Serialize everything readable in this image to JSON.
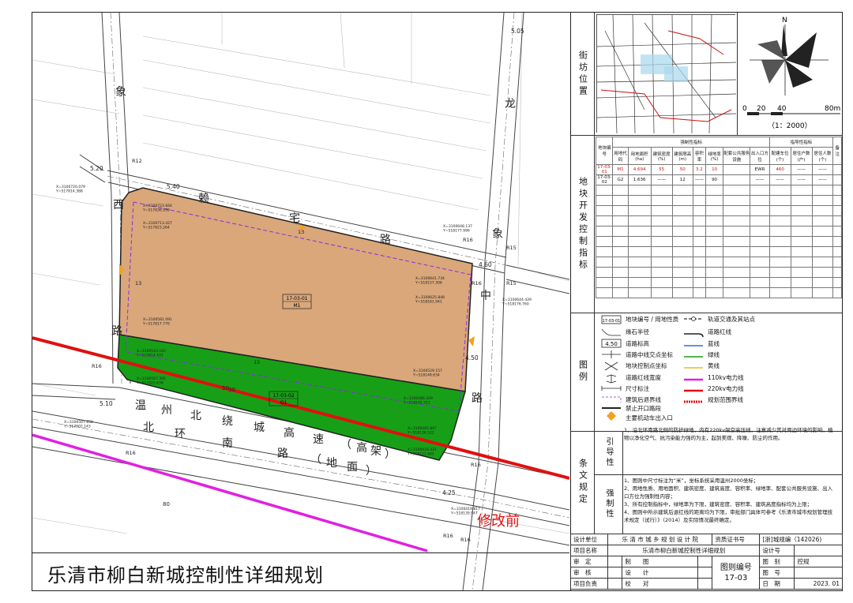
{
  "map": {
    "parcel_main": {
      "code": "17-03-01",
      "use": "M1"
    },
    "parcel_green": {
      "code": "17-03-02",
      "use": "G1"
    },
    "roads": {
      "xiang_west": "象",
      "xiang_west2": "西",
      "xiang_west3": "路",
      "long_east1": "龙",
      "long_east2": "象",
      "long_east3": "中",
      "long_east4": "路",
      "laizhai1": "赖",
      "laizhai2": "宅",
      "laizhai3": "路",
      "highway": [
        "温",
        "州",
        "北",
        "绕",
        "城",
        "高",
        "速",
        "（",
        "高",
        "架",
        "）"
      ],
      "ring": [
        "北",
        "环",
        "南",
        "路",
        "（",
        "地",
        "面",
        "）"
      ]
    },
    "dims": [
      "5.05",
      "5.20",
      "5.40",
      "4.60",
      "4.50",
      "5.10",
      "4.25",
      "R12",
      "R16",
      "R16",
      "R15",
      "R15",
      "R16",
      "R16",
      "R16",
      "R16",
      "R16",
      "13",
      "13",
      "15",
      "30",
      "50",
      "80"
    ],
    "coords": [
      "X=3100720.079\nY=517814.388",
      "X=3100723.664\nY=517836.939",
      "X=3100713.427\nY=517823.264",
      "X=3100648.137\nY=518177.996",
      "X=3100641.734\nY=518157.306",
      "X=3100625.848\nY=518161.941",
      "X=3100644.429\nY=518176.760",
      "X=3100581.091\nY=517817.770",
      "X=3100543.162\nY=517814.431",
      "X=3100507.395\nY=517825.638",
      "X=3100529.157\nY=518148.634",
      "X=3100486.309\nY=518142.311",
      "X=3100507.658\nY=517802.143",
      "X=3100465.867\nY=518136.522",
      "X=3100433.321\nY=518121.665",
      "X=3100419.817\nY=518139.947"
    ],
    "revision_stamp": "修改前"
  },
  "title": "乐清市柳白新城控制性详细规划",
  "side": {
    "location_title": "街坊位置",
    "scale_text": "（1：2000）",
    "scale_ticks": [
      "0",
      "20",
      "40",
      "80m"
    ],
    "north_label": "N",
    "control_title": "地块开发控制指标",
    "control_header_groups": [
      "强制性指标",
      "指导性指标"
    ],
    "control_headers": [
      "地块编号",
      "用地代码",
      "用地面积(ha)",
      "建筑密度(%)",
      "建筑限高(m)",
      "容积率",
      "绿地率(%)",
      "配套公共服务设施",
      "出入口方位",
      "配建车位(个)",
      "居住户数(户)",
      "居住人数(个)",
      "备注"
    ],
    "control_rows": [
      [
        "17-03-01",
        "M1",
        "4.694",
        "55",
        "50",
        "3.2",
        "10",
        "",
        "EWR",
        "460",
        "——",
        "——",
        ""
      ],
      [
        "17-03-02",
        "G2",
        "1.636",
        "——",
        "12",
        "——",
        "90",
        "",
        "——",
        "——",
        "——",
        "——",
        ""
      ]
    ],
    "legend_title": "图例",
    "legend_items": [
      [
        "地块编号 / 用地性质",
        "轨道交通及其站点"
      ],
      [
        "缘石半径",
        "道路红线"
      ],
      [
        "道路标高",
        "蓝线"
      ],
      [
        "道路中线交点坐标",
        "绿线"
      ],
      [
        "地块控制点坐标",
        "黄线"
      ],
      [
        "道路红线宽度",
        "110kv电力线"
      ],
      [
        "尺寸标注",
        "220kv电力线"
      ],
      [
        "建筑后退界线",
        "规划范围界线"
      ],
      [
        "禁止开口路段",
        ""
      ],
      [
        "主要机动车出入口",
        ""
      ]
    ],
    "legend_sample_labels": [
      "17-03-01",
      "4.50"
    ],
    "clause_title": "条文规定",
    "guide_title": "引导性",
    "guide_text": "1、沿北环南路北侧的防护绿地，内有220kv架空高压线，注意减少其对周边环境的影响，植物以净化空气、抗污染能力强的为主，起到美观、降噪、防尘的作用。",
    "force_title": "强制性",
    "force_text": [
      "1、图则中尺寸标注为“米”，坐标系统采用温州2000坐标；",
      "2、用地性质、用地面积、建筑密度、建筑高度、容积率、绿地率、配套公共服务设施、出入口方位为强制性内容；",
      "3、所有控制指标中，绿地率为下限，建筑密度、容积率、建筑高度指标均为上限；",
      "4、图则中所示建筑后退红线的距离均为下限，审批部门具体可参考《乐清市城市规划管理技术规定（试行）》（2014）及实际情况最终确定。"
    ]
  },
  "title_block": {
    "design_unit_label": "设计单位",
    "design_unit": "乐 清 市 城 乡 规 划 设 计 院",
    "cert_label": "资质证书号",
    "cert_no": "[浙]城规编（142026)",
    "project_label": "项目名称",
    "project": "乐清市柳白新城控制性详细规划",
    "design_no_label": "设计号",
    "review_label": "审　定",
    "drawing_label": "制　　图",
    "drawing_no_label": "图则编号",
    "drawing_no": "17-03",
    "category_label": "图　别",
    "category": "控规",
    "check_label": "审　核",
    "design_label": "设　　计",
    "sheet_label": "图　号",
    "leader_label": "项目负责",
    "proof_label": "校　　对",
    "date_label": "日　期",
    "date": "2023. 01"
  }
}
